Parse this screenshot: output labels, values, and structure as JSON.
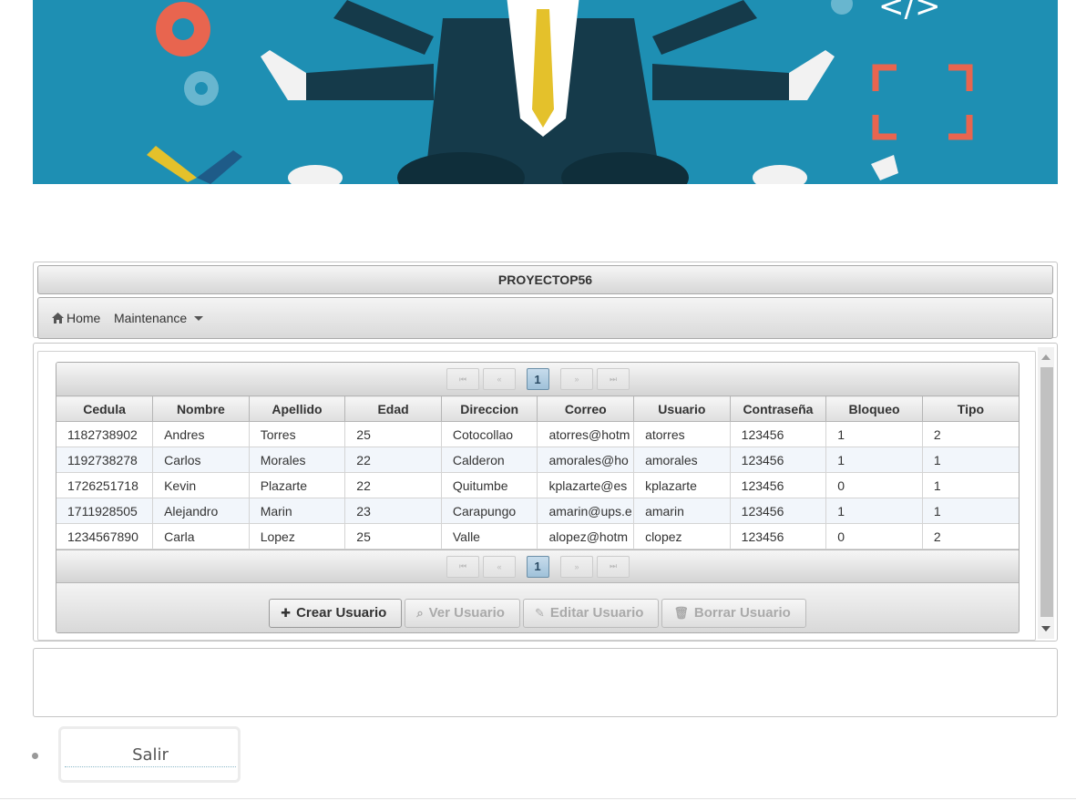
{
  "app": {
    "title": "PROYECTOP56"
  },
  "menu": {
    "home": "Home",
    "maintenance": "Maintenance"
  },
  "paginator": {
    "current_page": "1",
    "first": "⏮",
    "prev": "«",
    "next": "»",
    "last": "⏭"
  },
  "table": {
    "columns": [
      "Cedula",
      "Nombre",
      "Apellido",
      "Edad",
      "Direccion",
      "Correo",
      "Usuario",
      "Contraseña",
      "Bloqueo",
      "Tipo"
    ],
    "rows": [
      [
        "1182738902",
        "Andres",
        "Torres",
        "25",
        "Cotocollao",
        "atorres@hotm",
        "atorres",
        "123456",
        "1",
        "2"
      ],
      [
        "1192738278",
        "Carlos",
        "Morales",
        "22",
        "Calderon",
        "amorales@ho",
        "amorales",
        "123456",
        "1",
        "1"
      ],
      [
        "1726251718",
        "Kevin",
        "Plazarte",
        "22",
        "Quitumbe",
        "kplazarte@es",
        "kplazarte",
        "123456",
        "0",
        "1"
      ],
      [
        "1711928505",
        "Alejandro",
        "Marin",
        "23",
        "Carapungo",
        "amarin@ups.e",
        "amarin",
        "123456",
        "1",
        "1"
      ],
      [
        "1234567890",
        "Carla",
        "Lopez",
        "25",
        "Valle",
        "alopez@hotm",
        "clopez",
        "123456",
        "0",
        "2"
      ]
    ]
  },
  "actions": {
    "create": "Crear Usuario",
    "view": "Ver Usuario",
    "edit": "Editar Usuario",
    "delete": "Borrar Usuario"
  },
  "logout": {
    "label": "Salir"
  },
  "colors": {
    "banner_bg": "#1e8fb3",
    "page_active": "#9fc1d9",
    "row_alt": "#f2f6fb"
  }
}
